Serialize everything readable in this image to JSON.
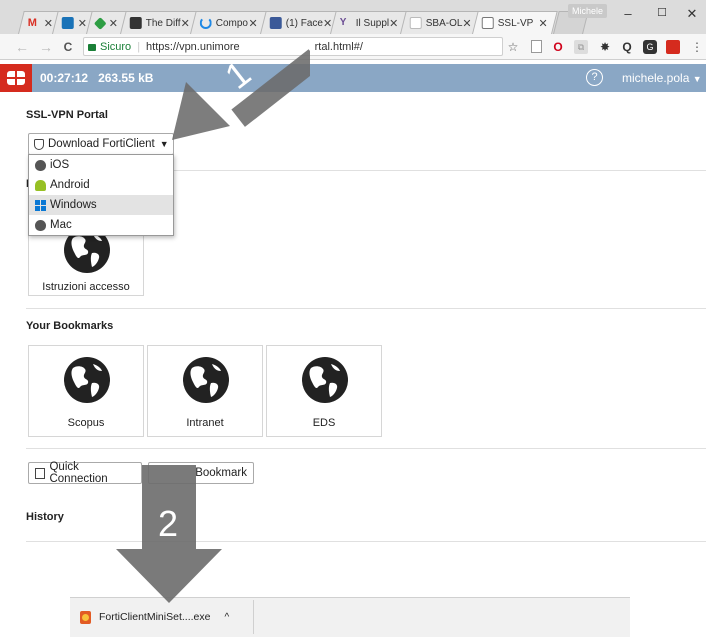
{
  "browser": {
    "tabs": [
      {
        "label": "",
        "favicon_color": "#d93025"
      },
      {
        "label": "",
        "favicon_color": "#1a73b8"
      },
      {
        "label": "",
        "favicon_color": "#2e9e44"
      },
      {
        "label": "The Diff",
        "favicon_color": "#333333"
      },
      {
        "label": "Compo",
        "favicon_color": "#1e88e5"
      },
      {
        "label": "(1) Face",
        "favicon_color": "#3b5998"
      },
      {
        "label": "Il Suppl",
        "favicon_color": "#6a4c93"
      },
      {
        "label": "SBA-OL",
        "favicon_color": "#bbbbbb"
      },
      {
        "label": "SSL-VP",
        "favicon_color": "#777777"
      }
    ],
    "profile_name": "Michele",
    "window_controls": {
      "minimize": "–",
      "maximize": "☐",
      "close": "✕"
    },
    "nav": {
      "back": "←",
      "forward": "→",
      "reload": "C"
    },
    "secure_label": "Sicuro",
    "url": "https://vpn.unimore",
    "url_tail": "rtal.html#/"
  },
  "header": {
    "session_time": "00:27:12",
    "traffic": "263.55 kB",
    "help": "?",
    "username": "michele.pola"
  },
  "portal": {
    "title": "SSL-VPN Portal",
    "download_button": "Download FortiClient",
    "download_options": [
      "iOS",
      "Android",
      "Windows",
      "Mac"
    ],
    "hidden_section_first_letter": "I",
    "quick_links": [
      {
        "label": "Istruzioni accesso"
      }
    ],
    "bookmarks_title": "Your Bookmarks",
    "bookmarks": [
      {
        "label": "Scopus"
      },
      {
        "label": "Intranet"
      },
      {
        "label": "EDS"
      }
    ],
    "quick_connection": "Quick Connection",
    "new_bookmark_visible": "Bookmark",
    "history_title": "History"
  },
  "annotations": {
    "step1": "1",
    "step2": "2"
  },
  "downloads": {
    "filename": "FortiClientMiniSet....exe"
  }
}
